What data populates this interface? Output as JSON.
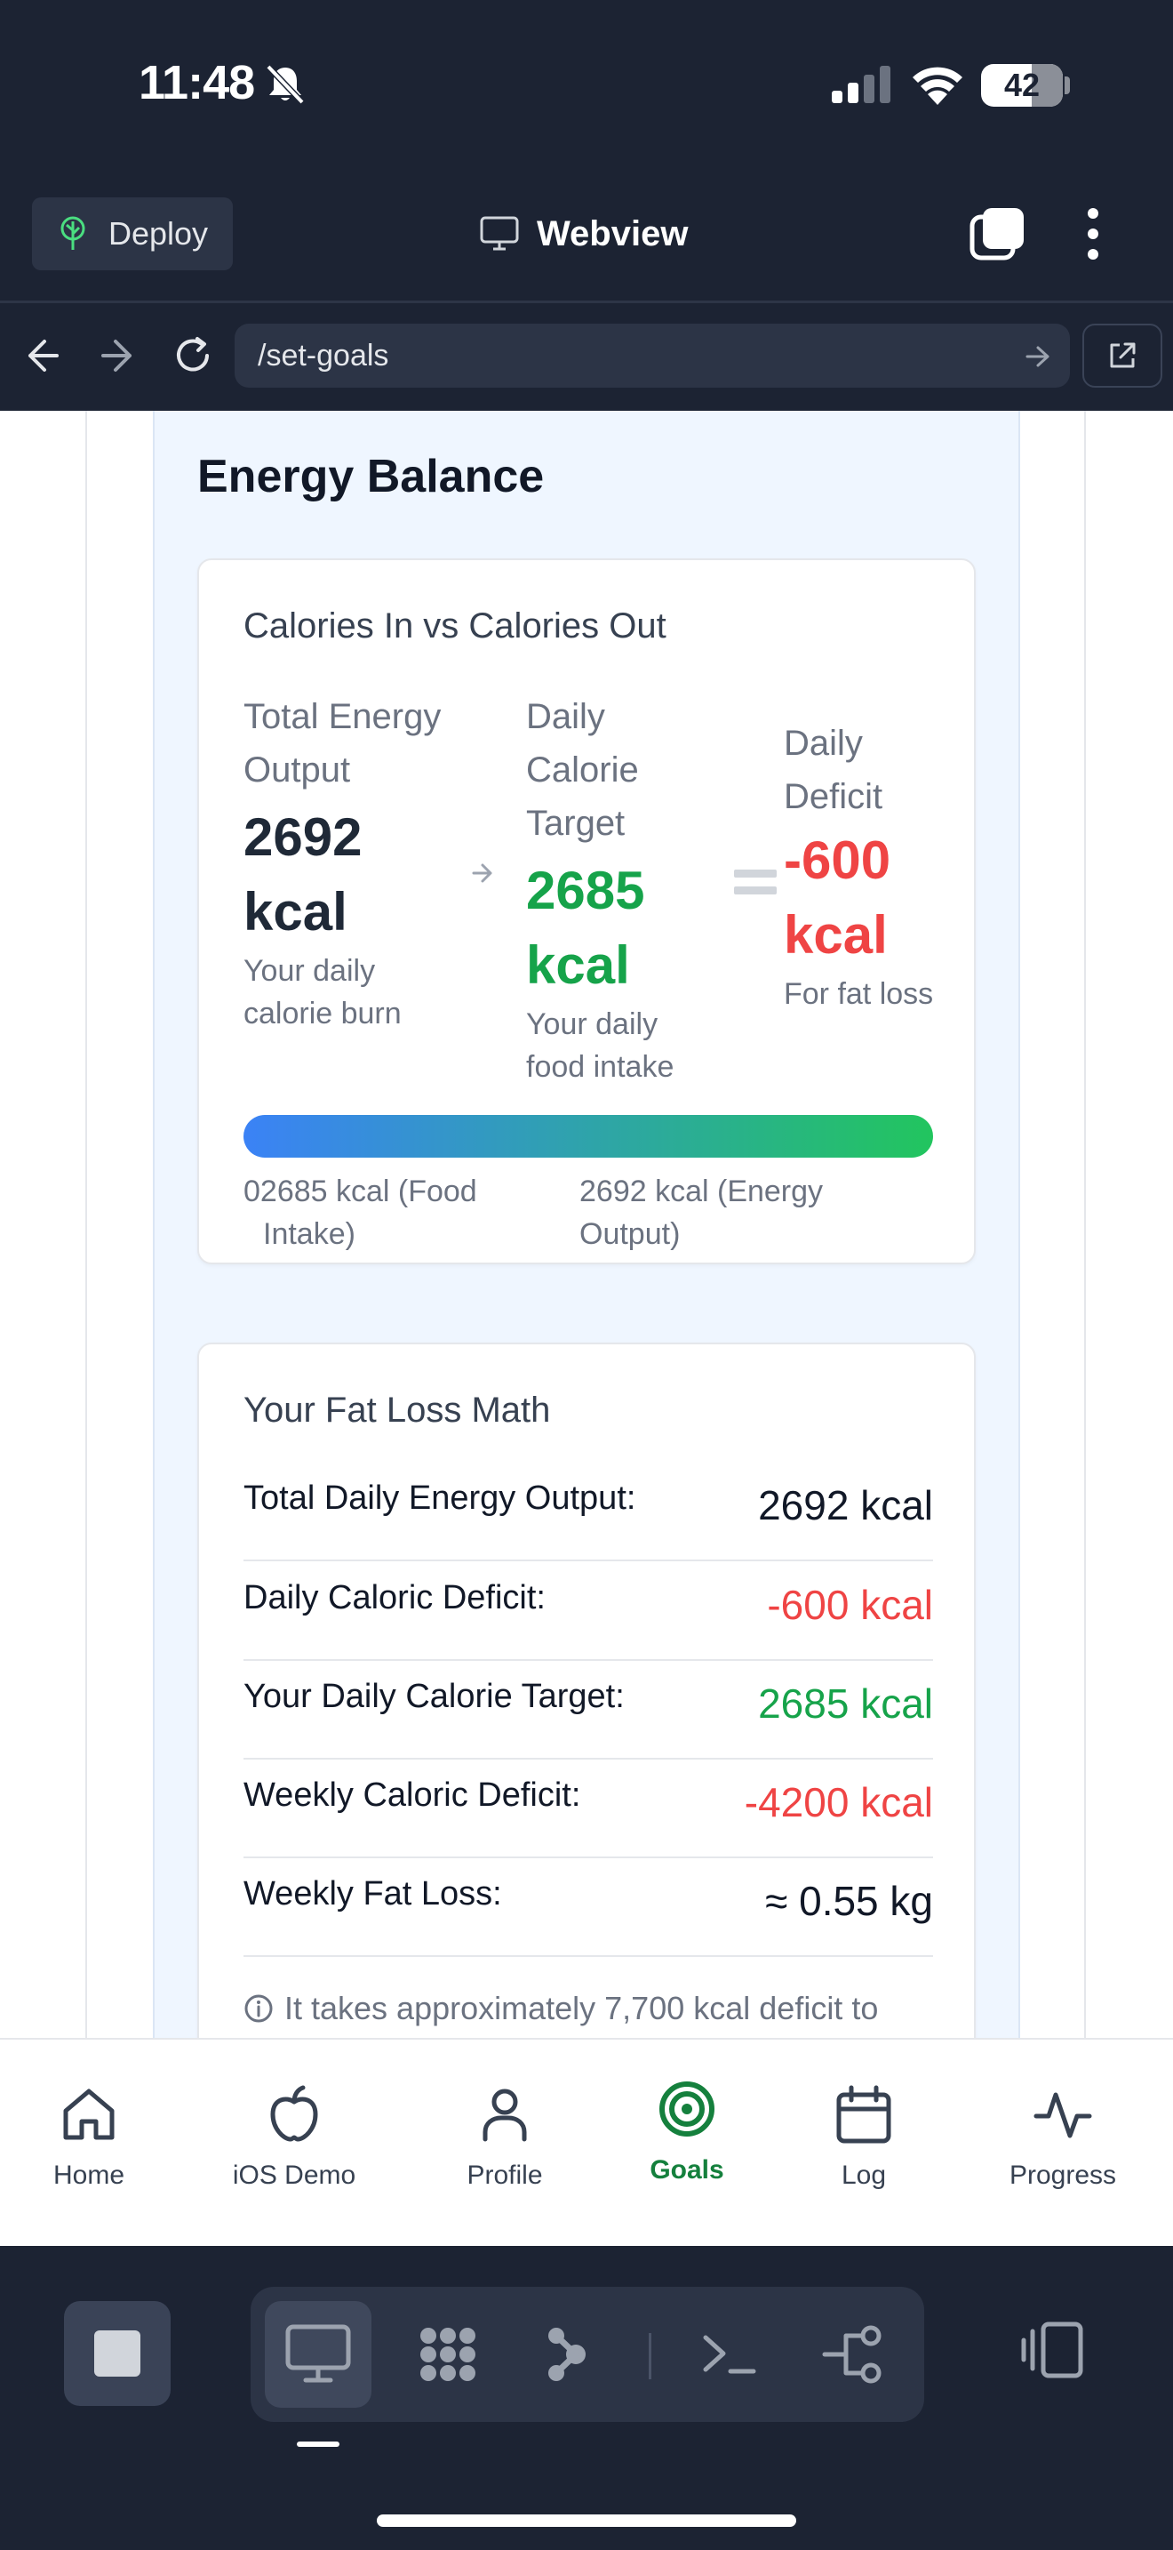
{
  "status_bar": {
    "time": "11:48",
    "battery": "42",
    "icons": [
      "bell-slash-icon",
      "cellular-signal-icon",
      "wifi-icon",
      "battery-icon"
    ]
  },
  "app_bar": {
    "deploy_label": "Deploy",
    "title": "Webview",
    "icons": [
      "deploy-icon",
      "monitor-icon",
      "tabs-icon",
      "more-vertical-icon"
    ]
  },
  "url_bar": {
    "url": "/set-goals",
    "icons": [
      "arrow-left-icon",
      "arrow-right-icon",
      "reload-icon",
      "go-arrow-icon",
      "external-link-icon"
    ]
  },
  "page": {
    "title": "Energy Balance",
    "balance_card": {
      "title": "Calories In vs Calories Out",
      "output": {
        "label": "Total Energy Output",
        "value": "2692 kcal",
        "sub": "Your daily calorie burn"
      },
      "target": {
        "label": "Daily Calorie Target",
        "value": "2685 kcal",
        "sub": "Your daily food intake"
      },
      "deficit": {
        "label": "Daily Deficit",
        "value": "-600 kcal",
        "sub": "For fat loss"
      },
      "bar_left_label": "02685 kcal (Food",
      "bar_left_label_2": "Intake)",
      "bar_right_label": "2692 kcal (Energy Output)"
    },
    "math_card": {
      "title": "Your Fat Loss Math",
      "rows": [
        {
          "label": "Total Daily Energy Output:",
          "value": "2692 kcal"
        },
        {
          "label": "Daily Caloric Deficit:",
          "value": "-600 kcal"
        },
        {
          "label": "Your Daily Calorie Target:",
          "value": "2685 kcal"
        },
        {
          "label": "Weekly Caloric Deficit:",
          "value": "-4200 kcal"
        },
        {
          "label": "Weekly Fat Loss:",
          "value": "≈ 0.55 kg"
        }
      ],
      "note": "It takes approximately 7,700 kcal deficit to"
    }
  },
  "tab_bar": {
    "active": "Goals",
    "tabs": [
      {
        "label": "Home",
        "icon": "home-icon"
      },
      {
        "label": "iOS Demo",
        "icon": "apple-icon"
      },
      {
        "label": "Profile",
        "icon": "user-icon"
      },
      {
        "label": "Goals",
        "icon": "target-icon"
      },
      {
        "label": "Log",
        "icon": "calendar-icon"
      },
      {
        "label": "Progress",
        "icon": "activity-icon"
      }
    ]
  },
  "dev_toolbar": {
    "icons": [
      "stop-icon",
      "preview-icon",
      "apps-icon",
      "agent-icon",
      "shell-icon",
      "git-icon",
      "layout-icon"
    ]
  },
  "colors": {
    "accent_green": "#16a34a",
    "deficit_red": "#ef4444",
    "panel_bg": "#eff6ff",
    "chrome_bg": "#1c2333",
    "bar_gradient": [
      "#3b82f6",
      "#22c55e"
    ]
  }
}
